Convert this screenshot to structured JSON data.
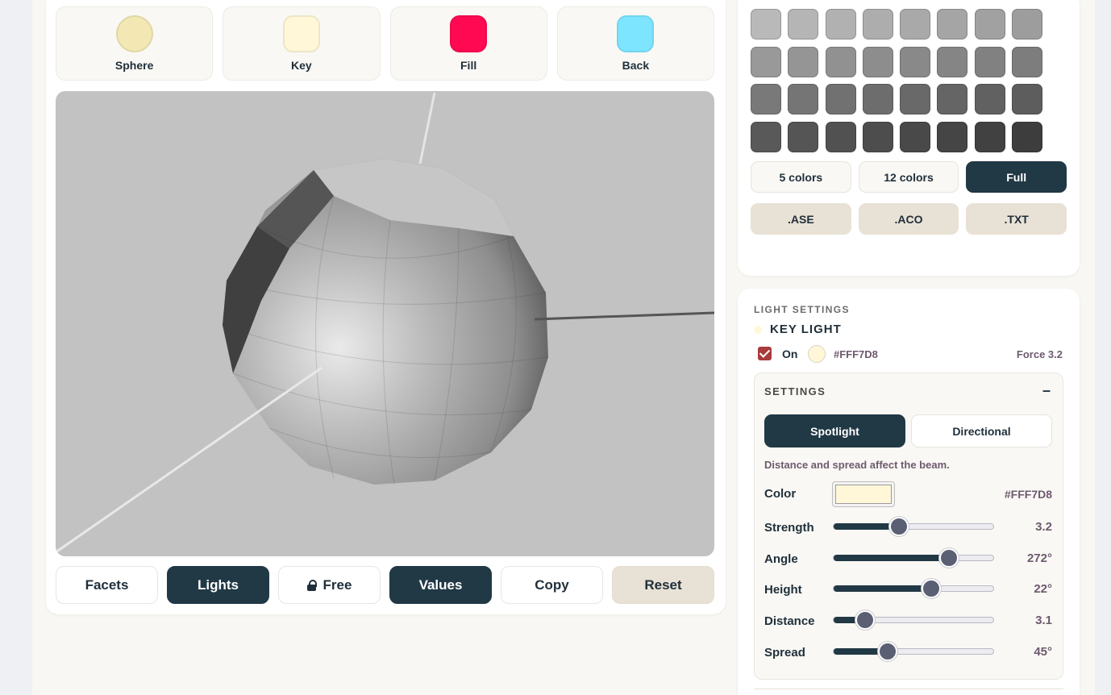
{
  "tiles": [
    {
      "label": "Sphere",
      "color": "#f3e8b4",
      "shape": "circle"
    },
    {
      "label": "Key",
      "color": "#fff7d8",
      "shape": "rounded"
    },
    {
      "label": "Fill",
      "color": "#ff0a52",
      "shape": "rounded"
    },
    {
      "label": "Back",
      "color": "#7de5ff",
      "shape": "rounded"
    }
  ],
  "viewport": {
    "background": "#c2c2c2"
  },
  "bottom_bar": {
    "facets": "Facets",
    "lights": "Lights",
    "free": "Free",
    "values": "Values",
    "copy": "Copy",
    "reset": "Reset"
  },
  "palette": {
    "swatches": [
      "#b9b9b9",
      "#b5b5b5",
      "#b1b1b1",
      "#adadad",
      "#a9a9a9",
      "#a5a5a5",
      "#a1a1a1",
      "#9d9d9d",
      "#999999",
      "#959595",
      "#919191",
      "#8d8d8d",
      "#898989",
      "#858585",
      "#818181",
      "#7d7d7d",
      "#797979",
      "#757575",
      "#717171",
      "#6d6d6d",
      "#696969",
      "#656565",
      "#616161",
      "#5d5d5d",
      "#595959",
      "#555555",
      "#515151",
      "#4d4d4d",
      "#494949",
      "#454545",
      "#414141",
      "#3d3d3d"
    ],
    "count_options": [
      "5 colors",
      "12 colors",
      "Full"
    ],
    "export_options": [
      ".ASE",
      ".ACO",
      ".TXT"
    ]
  },
  "light": {
    "section_label": "LIGHT SETTINGS",
    "name": "KEY LIGHT",
    "on_label": "On",
    "hex": "#FFF7D8",
    "force": "Force 3.2",
    "settings_title": "SETTINGS",
    "collapse": "–",
    "modes": [
      "Spotlight",
      "Directional"
    ],
    "hint": "Distance and spread affect the beam.",
    "color_label": "Color",
    "color_hex": "#FFF7D8",
    "controls": [
      {
        "label": "Strength",
        "value": "3.2",
        "fraction": 0.41
      },
      {
        "label": "Angle",
        "value": "272°",
        "fraction": 0.72
      },
      {
        "label": "Height",
        "value": "22°",
        "fraction": 0.61
      },
      {
        "label": "Distance",
        "value": "3.1",
        "fraction": 0.195
      },
      {
        "label": "Spread",
        "value": "45°",
        "fraction": 0.34
      }
    ]
  }
}
